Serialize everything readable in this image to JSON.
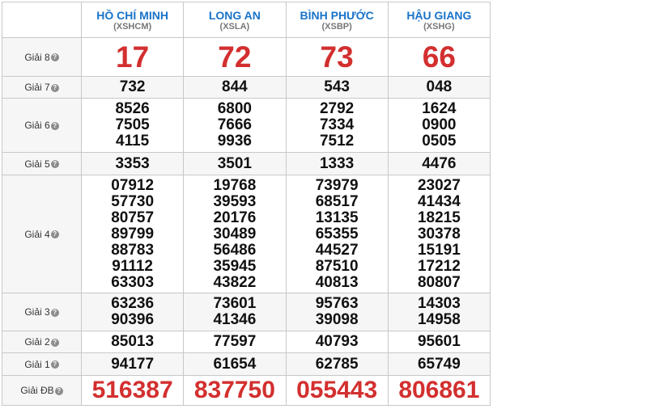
{
  "provinces": [
    {
      "name": "HỒ CHÍ MINH",
      "code": "(XSHCM)"
    },
    {
      "name": "LONG AN",
      "code": "(XSLA)"
    },
    {
      "name": "BÌNH PHƯỚC",
      "code": "(XSBP)"
    },
    {
      "name": "HẬU GIANG",
      "code": "(XSHG)"
    }
  ],
  "prizes": {
    "g8": {
      "label": "Giải 8",
      "values": [
        [
          "17"
        ],
        [
          "72"
        ],
        [
          "73"
        ],
        [
          "66"
        ]
      ]
    },
    "g7": {
      "label": "Giải 7",
      "values": [
        [
          "732"
        ],
        [
          "844"
        ],
        [
          "543"
        ],
        [
          "048"
        ]
      ]
    },
    "g6": {
      "label": "Giải 6",
      "values": [
        [
          "8526",
          "7505",
          "4115"
        ],
        [
          "6800",
          "7666",
          "9936"
        ],
        [
          "2792",
          "7334",
          "7512"
        ],
        [
          "1624",
          "0900",
          "0505"
        ]
      ]
    },
    "g5": {
      "label": "Giải 5",
      "values": [
        [
          "3353"
        ],
        [
          "3501"
        ],
        [
          "1333"
        ],
        [
          "4476"
        ]
      ]
    },
    "g4": {
      "label": "Giải 4",
      "values": [
        [
          "07912",
          "57730",
          "80757",
          "89799",
          "88783",
          "91112",
          "63303"
        ],
        [
          "19768",
          "39593",
          "20176",
          "30489",
          "56486",
          "35945",
          "43822"
        ],
        [
          "73979",
          "68517",
          "13135",
          "65355",
          "44527",
          "87510",
          "40813"
        ],
        [
          "23027",
          "41434",
          "18215",
          "30378",
          "15191",
          "17212",
          "80807"
        ]
      ]
    },
    "g3": {
      "label": "Giải 3",
      "values": [
        [
          "63236",
          "90396"
        ],
        [
          "73601",
          "41346"
        ],
        [
          "95763",
          "39098"
        ],
        [
          "14303",
          "14958"
        ]
      ]
    },
    "g2": {
      "label": "Giải 2",
      "values": [
        [
          "85013"
        ],
        [
          "77597"
        ],
        [
          "40793"
        ],
        [
          "95601"
        ]
      ]
    },
    "g1": {
      "label": "Giải 1",
      "values": [
        [
          "94177"
        ],
        [
          "61654"
        ],
        [
          "62785"
        ],
        [
          "65749"
        ]
      ]
    },
    "db": {
      "label": "Giải ĐB",
      "values": [
        [
          "516387"
        ],
        [
          "837750"
        ],
        [
          "055443"
        ],
        [
          "806861"
        ]
      ]
    }
  },
  "help_glyph": "?"
}
